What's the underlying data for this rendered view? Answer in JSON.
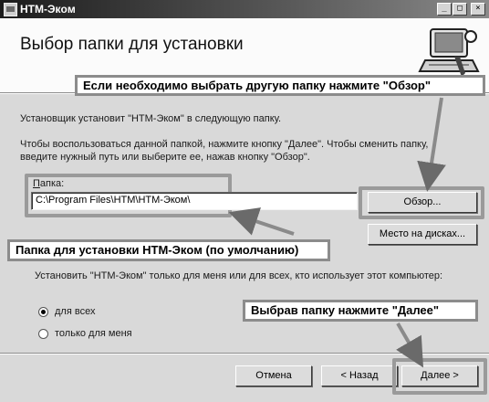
{
  "window": {
    "title": "HTM-Экoм",
    "title_buttons": [
      "_",
      "□",
      "×"
    ]
  },
  "header": {
    "title": "Выбор папки для установки"
  },
  "callouts": {
    "top": "Если необходимо выбрать другую папку нажмите \"Обзор\"",
    "middle": "Папка для установки НТМ-Экoм (по умолчанию)",
    "bottom": "Выбрав папку нажмите \"Далее\""
  },
  "body": {
    "line1": "Установщик установит \"НТМ-Экoм\" в следующую папку.",
    "line2a": "Чтобы воспользоваться данной папкой, нажмите кнопку \"Далее\". Чтобы сменить папку,",
    "line2b": "введите нужный путь или выберите ее, нажав кнопку \"Обзор\".",
    "folder_label": "Папка:",
    "folder_value": "C:\\Program Files\\HTM\\HTM-Экoм\\",
    "browse_button": "Обзор...",
    "disk_space_button": "Место на дисках...",
    "install_for": "Установить \"НТМ-Экoм\" только для меня или для всех, кто использует этот компьютер:",
    "radio_all": "для всех",
    "radio_me": "только для меня"
  },
  "footer": {
    "cancel": "Отмена",
    "back": "< Назад",
    "next": "Далее >"
  },
  "icons": {
    "title_icon": "installer-icon",
    "header_icon": "computer-icon",
    "arrow": "arrow-icon"
  },
  "colors": {
    "window_bg": "#d9d9d9",
    "header_bg": "#fbfbfb",
    "highlight": "#9a9a9a"
  }
}
